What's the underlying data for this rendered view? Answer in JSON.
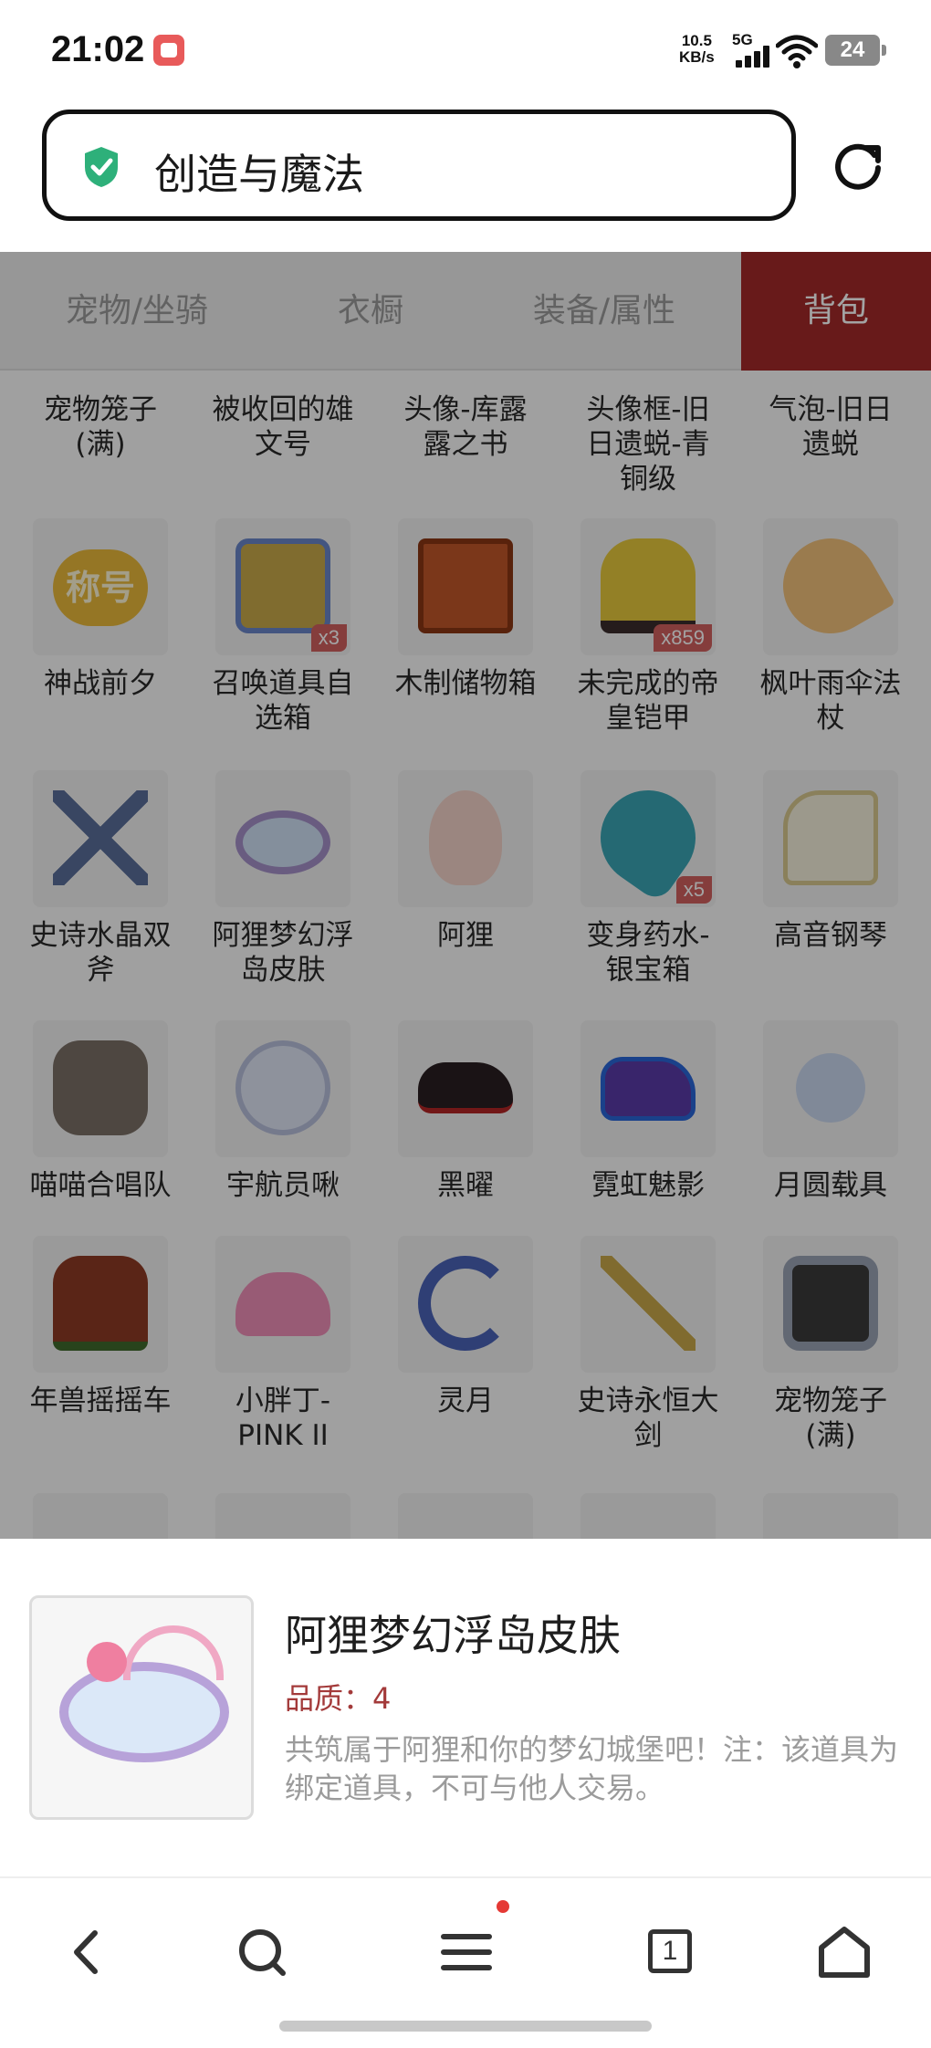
{
  "status_bar": {
    "time": "21:02",
    "net_speed_value": "10.5",
    "net_speed_unit": "KB/s",
    "network": "5G",
    "battery": "24"
  },
  "address_bar": {
    "title": "创造与魔法"
  },
  "tabs": [
    {
      "label": "宠物/坐骑",
      "active": false
    },
    {
      "label": "衣橱",
      "active": false
    },
    {
      "label": "装备/属性",
      "active": false
    },
    {
      "label": "背包",
      "active": true
    }
  ],
  "colors": {
    "accent": "#a32a2a",
    "badge": "#d1605f",
    "quality_text": "#a33a3a",
    "shield": "#2eb07a"
  },
  "grid": {
    "rows": [
      [
        {
          "label": "宠物笼子\n(满)"
        },
        {
          "label": "被收回的雄\n文号"
        },
        {
          "label": "头像-库露\n露之书"
        },
        {
          "label": "头像框-旧\n日遗蜕-青\n铜级"
        },
        {
          "label": "气泡-旧日\n遗蜕"
        }
      ],
      [
        {
          "label": "神战前夕",
          "icon": "title-badge-icon",
          "icon_text": "称号"
        },
        {
          "label": "召唤道具自\n选箱",
          "icon": "treasure-chest-icon",
          "badge": "x3"
        },
        {
          "label": "木制储物箱",
          "icon": "wooden-box-icon"
        },
        {
          "label": "未完成的帝\n皇铠甲",
          "icon": "armor-stand-icon",
          "badge": "x859"
        },
        {
          "label": "枫叶雨伞法\n杖",
          "icon": "umbrella-icon"
        }
      ],
      [
        {
          "label": "史诗水晶双\n斧",
          "icon": "double-axe-icon"
        },
        {
          "label": "阿狸梦幻浮\n岛皮肤",
          "icon": "floating-island-icon"
        },
        {
          "label": "阿狸",
          "icon": "ali-fox-icon"
        },
        {
          "label": "变身药水-\n银宝箱",
          "icon": "potion-icon",
          "badge": "x5"
        },
        {
          "label": "高音钢琴",
          "icon": "piano-icon"
        }
      ],
      [
        {
          "label": "喵喵合唱队",
          "icon": "cats-icon"
        },
        {
          "label": "宇航员啾",
          "icon": "astronaut-icon"
        },
        {
          "label": "黑曜",
          "icon": "black-car-icon"
        },
        {
          "label": "霓虹魅影",
          "icon": "neon-car-icon"
        },
        {
          "label": "月圆载具",
          "icon": "moon-vehicle-icon"
        }
      ],
      [
        {
          "label": "年兽摇摇车",
          "icon": "nian-cart-icon"
        },
        {
          "label": "小胖丁-\nPINK II",
          "icon": "pink-beetle-icon"
        },
        {
          "label": "灵月",
          "icon": "crescent-moon-icon"
        },
        {
          "label": "史诗永恒大\n剑",
          "icon": "sword-icon"
        },
        {
          "label": "宠物笼子\n(满)",
          "icon": "pet-cage-icon"
        }
      ]
    ]
  },
  "detail_sheet": {
    "title": "阿狸梦幻浮岛皮肤",
    "quality": "品质：4",
    "description": "共筑属于阿狸和你的梦幻城堡吧！注：该道具为绑定道具，不可与他人交易。"
  },
  "nav_bar": {
    "tab_count": "1"
  }
}
